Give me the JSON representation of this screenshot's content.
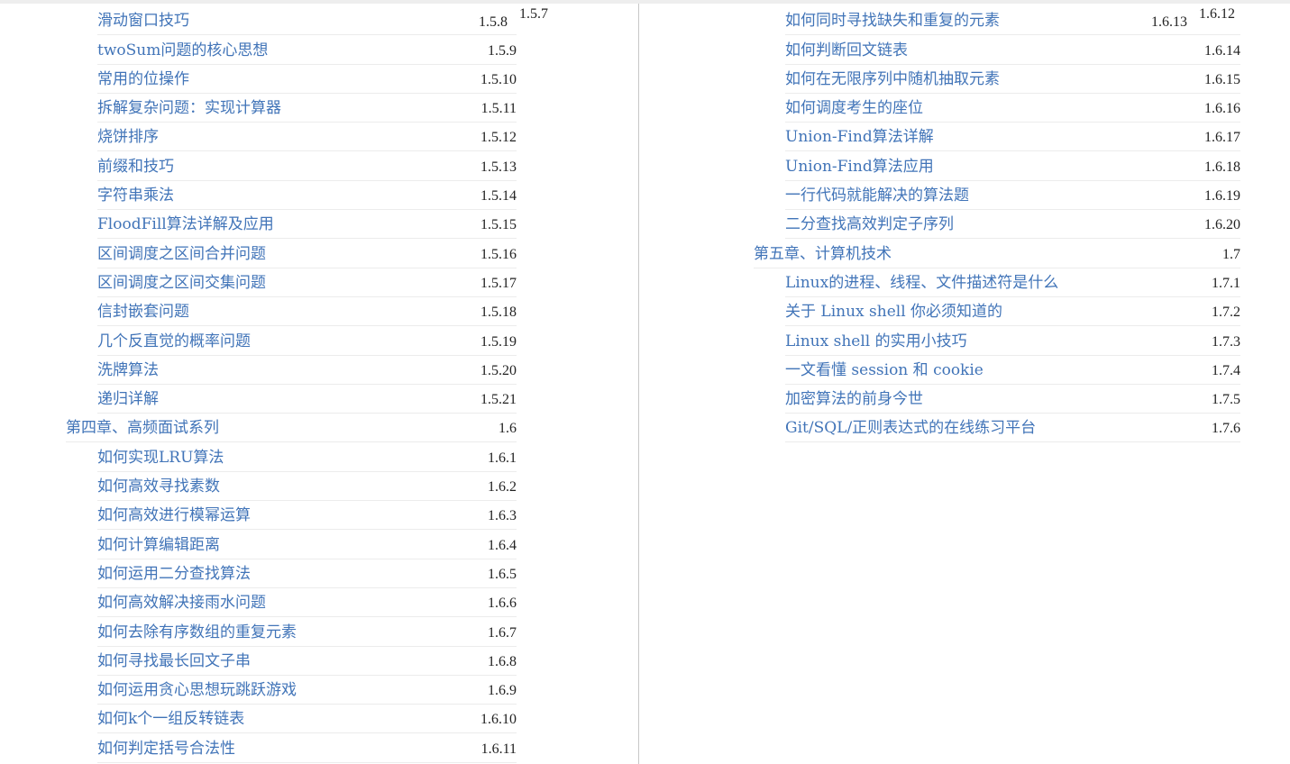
{
  "left": {
    "first_row": {
      "title": "滑动窗口技巧",
      "num_inline": "1.5.8",
      "num": "1.5.7"
    },
    "rows": [
      {
        "title": "twoSum问题的核心思想",
        "num": "1.5.9",
        "level": 2
      },
      {
        "title": "常用的位操作",
        "num": "1.5.10",
        "level": 2
      },
      {
        "title": "拆解复杂问题：实现计算器",
        "num": "1.5.11",
        "level": 2
      },
      {
        "title": "烧饼排序",
        "num": "1.5.12",
        "level": 2
      },
      {
        "title": "前缀和技巧",
        "num": "1.5.13",
        "level": 2
      },
      {
        "title": "字符串乘法",
        "num": "1.5.14",
        "level": 2
      },
      {
        "title": "FloodFill算法详解及应用",
        "num": "1.5.15",
        "level": 2
      },
      {
        "title": "区间调度之区间合并问题",
        "num": "1.5.16",
        "level": 2
      },
      {
        "title": "区间调度之区间交集问题",
        "num": "1.5.17",
        "level": 2
      },
      {
        "title": "信封嵌套问题",
        "num": "1.5.18",
        "level": 2
      },
      {
        "title": "几个反直觉的概率问题",
        "num": "1.5.19",
        "level": 2
      },
      {
        "title": "洗牌算法",
        "num": "1.5.20",
        "level": 2
      },
      {
        "title": "递归详解",
        "num": "1.5.21",
        "level": 2
      },
      {
        "title": "第四章、高频面试系列",
        "num": "1.6",
        "level": 1
      },
      {
        "title": "如何实现LRU算法",
        "num": "1.6.1",
        "level": 2
      },
      {
        "title": "如何高效寻找素数",
        "num": "1.6.2",
        "level": 2
      },
      {
        "title": "如何高效进行模幂运算",
        "num": "1.6.3",
        "level": 2
      },
      {
        "title": "如何计算编辑距离",
        "num": "1.6.4",
        "level": 2
      },
      {
        "title": "如何运用二分查找算法",
        "num": "1.6.5",
        "level": 2
      },
      {
        "title": "如何高效解决接雨水问题",
        "num": "1.6.6",
        "level": 2
      },
      {
        "title": "如何去除有序数组的重复元素",
        "num": "1.6.7",
        "level": 2
      },
      {
        "title": "如何寻找最长回文子串",
        "num": "1.6.8",
        "level": 2
      },
      {
        "title": "如何运用贪心思想玩跳跃游戏",
        "num": "1.6.9",
        "level": 2
      },
      {
        "title": "如何k个一组反转链表",
        "num": "1.6.10",
        "level": 2
      },
      {
        "title": "如何判定括号合法性",
        "num": "1.6.11",
        "level": 2
      }
    ]
  },
  "right": {
    "first_row": {
      "title": "如何同时寻找缺失和重复的元素",
      "num_inline": "1.6.13",
      "num": "1.6.12"
    },
    "rows": [
      {
        "title": "如何判断回文链表",
        "num": "1.6.14",
        "level": 2
      },
      {
        "title": "如何在无限序列中随机抽取元素",
        "num": "1.6.15",
        "level": 2
      },
      {
        "title": "如何调度考生的座位",
        "num": "1.6.16",
        "level": 2
      },
      {
        "title": "Union-Find算法详解",
        "num": "1.6.17",
        "level": 2
      },
      {
        "title": "Union-Find算法应用",
        "num": "1.6.18",
        "level": 2
      },
      {
        "title": "一行代码就能解决的算法题",
        "num": "1.6.19",
        "level": 2
      },
      {
        "title": "二分查找高效判定子序列",
        "num": "1.6.20",
        "level": 2
      },
      {
        "title": "第五章、计算机技术",
        "num": "1.7",
        "level": 1
      },
      {
        "title": "Linux的进程、线程、文件描述符是什么",
        "num": "1.7.1",
        "level": 2
      },
      {
        "title": "关于 Linux shell 你必须知道的",
        "num": "1.7.2",
        "level": 2
      },
      {
        "title": "Linux shell 的实用小技巧",
        "num": "1.7.3",
        "level": 2
      },
      {
        "title": "一文看懂 session 和 cookie",
        "num": "1.7.4",
        "level": 2
      },
      {
        "title": "加密算法的前身今世",
        "num": "1.7.5",
        "level": 2
      },
      {
        "title": "Git/SQL/正则表达式的在线练习平台",
        "num": "1.7.6",
        "level": 2
      }
    ]
  }
}
